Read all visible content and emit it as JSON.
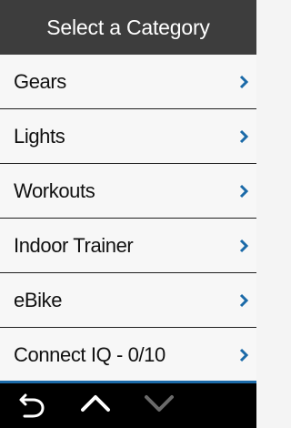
{
  "header": {
    "title": "Select a Category"
  },
  "list": {
    "items": [
      {
        "label": "Gears",
        "icon": "chevron-right-icon"
      },
      {
        "label": "Lights",
        "icon": "chevron-right-icon"
      },
      {
        "label": "Workouts",
        "icon": "chevron-right-icon"
      },
      {
        "label": "Indoor Trainer",
        "icon": "chevron-right-icon"
      },
      {
        "label": "eBike",
        "icon": "chevron-right-icon"
      },
      {
        "label": "Connect IQ - 0/10",
        "icon": "chevron-right-icon"
      }
    ]
  },
  "bottom_bar": {
    "back_icon": "back-arrow-icon",
    "up_icon": "chevron-up-icon",
    "down_icon": "chevron-down-icon"
  },
  "colors": {
    "header_bg": "#3d3d3d",
    "accent": "#1b6aa8",
    "list_bg": "#f7f7f7",
    "bottom_bar_bg": "#000000",
    "down_disabled": "#6a6a6a"
  }
}
